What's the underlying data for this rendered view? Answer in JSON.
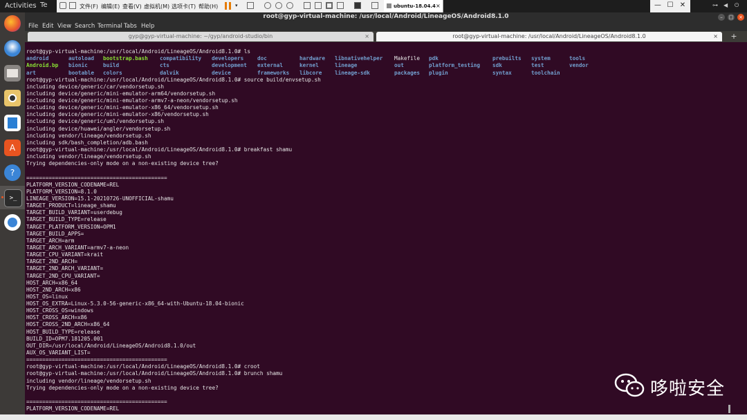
{
  "topbar": {
    "activities": "Activities",
    "te_tab": "Te"
  },
  "vm_toolbar": {
    "menus": [
      "文件(F)",
      "编辑(E)",
      "查看(V)",
      "虚拟机(M)",
      "选项卡(T)",
      "帮助(H)"
    ],
    "tab_label": "ubuntu-18.04.4",
    "tab_close": "×",
    "min": "—",
    "max": "☐",
    "close": "✕"
  },
  "dock": {
    "apps": [
      "firefox-icon",
      "thunderbird-icon",
      "files-icon",
      "rhythmbox-icon",
      "writer-icon",
      "software-icon",
      "help-icon",
      "terminal-icon",
      "android-studio-icon"
    ]
  },
  "terminal_window": {
    "title": "root@gyp-virtual-machine: /usr/local/Android/LineageOS/Android8.1.0",
    "menu": [
      "File",
      "Edit",
      "View",
      "Search",
      "Terminal",
      "Tabs",
      "Help"
    ],
    "tabs": [
      {
        "label": "gyp@gyp-virtual-machine: ~/gyp/android-studio/bin"
      },
      {
        "label": "root@gyp-virtual-machine: /usr/local/Android/LineageOS/Android8.1.0"
      }
    ],
    "tab_close": "×",
    "new_tab": "+"
  },
  "ls_output": [
    [
      {
        "t": "android",
        "k": "dir"
      },
      {
        "t": "autoload",
        "k": "dir"
      },
      {
        "t": "bootstrap.bash",
        "k": "exe"
      },
      {
        "t": "compatibility",
        "k": "dir"
      },
      {
        "t": "developers",
        "k": "dir"
      },
      {
        "t": "doc",
        "k": "dir"
      },
      {
        "t": "hardware",
        "k": "dir"
      },
      {
        "t": "libnativehelper",
        "k": "dir"
      },
      {
        "t": "Makefile",
        "k": "file"
      },
      {
        "t": "pdk",
        "k": "dir"
      },
      {
        "t": "prebuilts",
        "k": "dir"
      },
      {
        "t": "system",
        "k": "dir"
      },
      {
        "t": "tools",
        "k": "dir"
      }
    ],
    [
      {
        "t": "Android.bp",
        "k": "exe"
      },
      {
        "t": "bionic",
        "k": "dir"
      },
      {
        "t": "build",
        "k": "dir"
      },
      {
        "t": "cts",
        "k": "dir"
      },
      {
        "t": "development",
        "k": "dir"
      },
      {
        "t": "external",
        "k": "dir"
      },
      {
        "t": "kernel",
        "k": "dir"
      },
      {
        "t": "lineage",
        "k": "dir"
      },
      {
        "t": "out",
        "k": "dir"
      },
      {
        "t": "platform_testing",
        "k": "dir"
      },
      {
        "t": "sdk",
        "k": "dir"
      },
      {
        "t": "test",
        "k": "dir"
      },
      {
        "t": "vendor",
        "k": "dir"
      }
    ],
    [
      {
        "t": "art",
        "k": "dir"
      },
      {
        "t": "bootable",
        "k": "dir"
      },
      {
        "t": "colors",
        "k": "dir"
      },
      {
        "t": "dalvik",
        "k": "dir"
      },
      {
        "t": "device",
        "k": "dir"
      },
      {
        "t": "frameworks",
        "k": "dir"
      },
      {
        "t": "libcore",
        "k": "dir"
      },
      {
        "t": "lineage-sdk",
        "k": "dir"
      },
      {
        "t": "packages",
        "k": "dir"
      },
      {
        "t": "plugin",
        "k": "dir"
      },
      {
        "t": "syntax",
        "k": "dir"
      },
      {
        "t": "toolchain",
        "k": "dir"
      }
    ]
  ],
  "lines_before": [
    "root@gyp-virtual-machine:/usr/local/Android/LineageOS/Android8.1.0# ls"
  ],
  "lines_after": [
    "root@gyp-virtual-machine:/usr/local/Android/LineageOS/Android8.1.0# source build/envsetup.sh",
    "including device/generic/car/vendorsetup.sh",
    "including device/generic/mini-emulator-arm64/vendorsetup.sh",
    "including device/generic/mini-emulator-armv7-a-neon/vendorsetup.sh",
    "including device/generic/mini-emulator-x86_64/vendorsetup.sh",
    "including device/generic/mini-emulator-x86/vendorsetup.sh",
    "including device/generic/uml/vendorsetup.sh",
    "including device/huawei/angler/vendorsetup.sh",
    "including vendor/lineage/vendorsetup.sh",
    "including sdk/bash_completion/adb.bash",
    "root@gyp-virtual-machine:/usr/local/Android/LineageOS/Android8.1.0# breakfast shamu",
    "including vendor/lineage/vendorsetup.sh",
    "Trying dependencies-only mode on a non-existing device tree?",
    "",
    "============================================",
    "PLATFORM_VERSION_CODENAME=REL",
    "PLATFORM_VERSION=8.1.0",
    "LINEAGE_VERSION=15.1-20210726-UNOFFICIAL-shamu",
    "TARGET_PRODUCT=lineage_shamu",
    "TARGET_BUILD_VARIANT=userdebug",
    "TARGET_BUILD_TYPE=release",
    "TARGET_PLATFORM_VERSION=OPM1",
    "TARGET_BUILD_APPS=",
    "TARGET_ARCH=arm",
    "TARGET_ARCH_VARIANT=armv7-a-neon",
    "TARGET_CPU_VARIANT=krait",
    "TARGET_2ND_ARCH=",
    "TARGET_2ND_ARCH_VARIANT=",
    "TARGET_2ND_CPU_VARIANT=",
    "HOST_ARCH=x86_64",
    "HOST_2ND_ARCH=x86",
    "HOST_OS=linux",
    "HOST_OS_EXTRA=Linux-5.3.0-56-generic-x86_64-with-Ubuntu-18.04-bionic",
    "HOST_CROSS_OS=windows",
    "HOST_CROSS_ARCH=x86",
    "HOST_CROSS_2ND_ARCH=x86_64",
    "HOST_BUILD_TYPE=release",
    "BUILD_ID=OPM7.181205.001",
    "OUT_DIR=/usr/local/Android/LineageOS/Android8.1.0/out",
    "AUX_OS_VARIANT_LIST=",
    "============================================",
    "root@gyp-virtual-machine:/usr/local/Android/LineageOS/Android8.1.0# croot",
    "root@gyp-virtual-machine:/usr/local/Android/LineageOS/Android8.1.0# brunch shamu",
    "including vendor/lineage/vendorsetup.sh",
    "Trying dependencies-only mode on a non-existing device tree?",
    "",
    "============================================",
    "PLATFORM_VERSION_CODENAME=REL"
  ],
  "watermark": {
    "text": "哆啦安全"
  }
}
